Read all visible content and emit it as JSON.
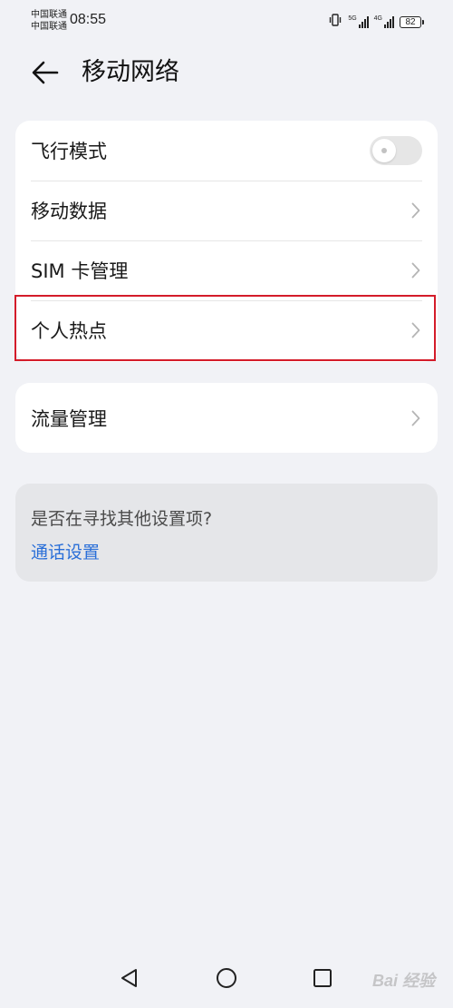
{
  "status_bar": {
    "carrier1": "中国联通",
    "carrier2": "中国联通",
    "time": "08:55",
    "sim1_network": "5G",
    "sim2_network": "4G",
    "battery_level": "82"
  },
  "header": {
    "title": "移动网络"
  },
  "settings": {
    "airplane_mode": {
      "label": "飞行模式",
      "enabled": false
    },
    "mobile_data": {
      "label": "移动数据"
    },
    "sim_management": {
      "label": "SIM 卡管理"
    },
    "hotspot": {
      "label": "个人热点"
    },
    "data_usage": {
      "label": "流量管理"
    }
  },
  "suggestion": {
    "question": "是否在寻找其他设置项?",
    "link": "通话设置"
  },
  "watermark": {
    "text": "Bai 经验"
  },
  "colors": {
    "background": "#f1f2f6",
    "card": "#ffffff",
    "link": "#2a6fd8",
    "highlight": "#d41c2a",
    "toggle_off": "#e6e6e6"
  },
  "icons": {
    "back": "back-arrow-icon",
    "chevron": "chevron-right-icon",
    "vibrate": "vibrate-icon",
    "nav_back": "triangle-back-icon",
    "nav_home": "circle-home-icon",
    "nav_recent": "square-recent-icon"
  }
}
